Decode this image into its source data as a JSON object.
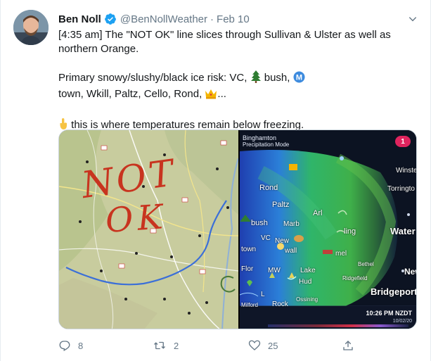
{
  "author": {
    "name": "Ben Noll",
    "handle": "@BenNollWeather",
    "separator": "·",
    "date": "Feb 10"
  },
  "tweet": {
    "line1": "[4:35 am] The \"NOT OK\" line slices through Sullivan & Ulster as well as",
    "line2": "northern Orange.",
    "line3a": "Primary snowy/slushy/black ice risk: VC, ",
    "line3b": " bush, ",
    "line4a": "town, Wkill, Paltz, Cello, Rond, ",
    "line4b": "...",
    "line5": " this is where temperatures remain below freezing."
  },
  "media": {
    "left_annotation": [
      "NOT",
      "OK"
    ],
    "radar": {
      "title": "Binghamton",
      "subtitle": "Precipitation Mode",
      "badge": "1",
      "time": "10:26 PM NZDT",
      "date": "10/02/20",
      "labels": {
        "winsted": "Winste",
        "rond": "Rond",
        "torrington": "Torringto",
        "paltz": "Paltz",
        "arl": "Arl",
        "bush": "bush",
        "marb": "Marb",
        "ling": "ling",
        "water": "Water",
        "vc": "VC",
        "new": "New",
        "town": "town",
        "wall": "wall",
        "mel": "mel",
        "bethel": "Bethel",
        "flor": "Flor",
        "mw": "MW",
        "lake": "Lake",
        "new2": "New",
        "hud": "Hud",
        "ridgefield": "Ridgefield",
        "l": "L",
        "bridgeport": "Bridgeport",
        "ossining": "Ossining",
        "rock": "Rock",
        "milford": "Milford"
      }
    }
  },
  "actions": {
    "reply_count": "8",
    "retweet_count": "2",
    "like_count": "25"
  },
  "colors": {
    "verified": "#1da1f2",
    "secondary_text": "#657786",
    "annotation_red": "#c8341f",
    "annotation_line": "#3b6fd8"
  }
}
